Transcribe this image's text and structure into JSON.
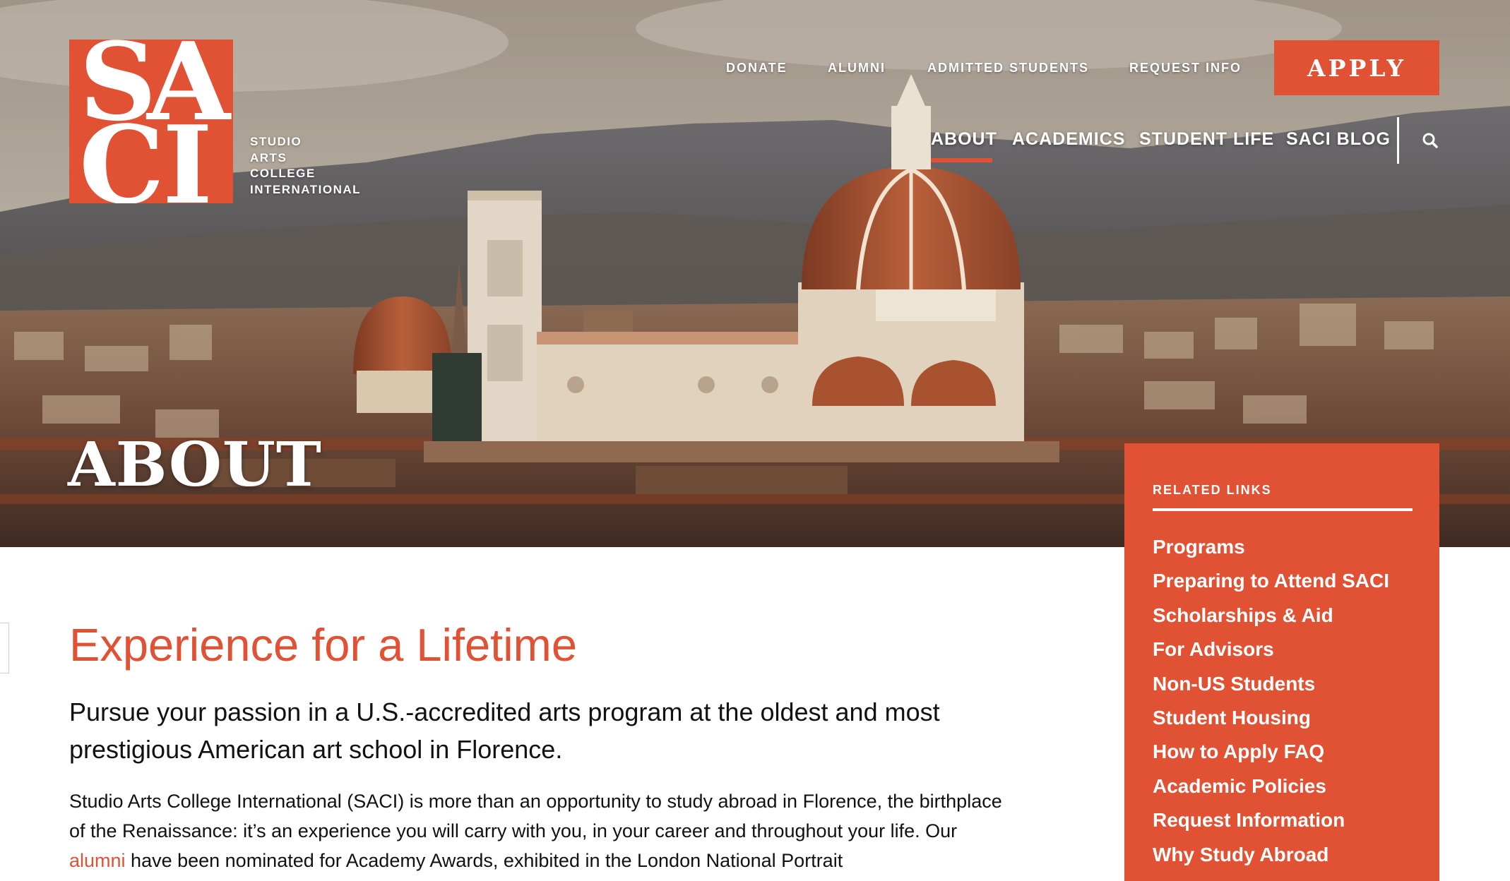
{
  "logo": {
    "letters": [
      "S",
      "A",
      "C",
      "I"
    ],
    "text_lines": [
      "STUDIO",
      "ARTS",
      "COLLEGE",
      "INTERNATIONAL"
    ]
  },
  "utility_nav": [
    "DONATE",
    "ALUMNI",
    "ADMITTED STUDENTS",
    "REQUEST INFO"
  ],
  "apply_label": "APPLY",
  "main_nav": [
    "ABOUT",
    "ACADEMICS",
    "STUDENT LIFE",
    "SACI BLOG"
  ],
  "active_nav": "ABOUT",
  "search_icon": "search-icon",
  "hero_title": "ABOUT",
  "content": {
    "heading": "Experience for a Lifetime",
    "lead": "Pursue your passion in a U.S.-accredited arts program at the oldest and most prestigious American art school in Florence.",
    "body_before_link": "Studio Arts College International (SACI) is more than an opportunity to study abroad in Florence, the birthplace of the Renaissance: it’s an experience you will carry with you, in your career and throughout your life. Our ",
    "body_link": "alumni",
    "body_after_link": " have been nominated for Academy Awards, exhibited in the London National Portrait"
  },
  "sidebar": {
    "heading": "RELATED LINKS",
    "links": [
      "Programs",
      "Preparing to Attend SACI",
      "Scholarships & Aid",
      "For Advisors",
      "Non-US Students",
      "Student Housing",
      "How to Apply FAQ",
      "Academic Policies",
      "Request Information",
      "Why Study Abroad"
    ]
  },
  "colors": {
    "accent": "#e05233",
    "text": "#111111",
    "white": "#ffffff"
  }
}
